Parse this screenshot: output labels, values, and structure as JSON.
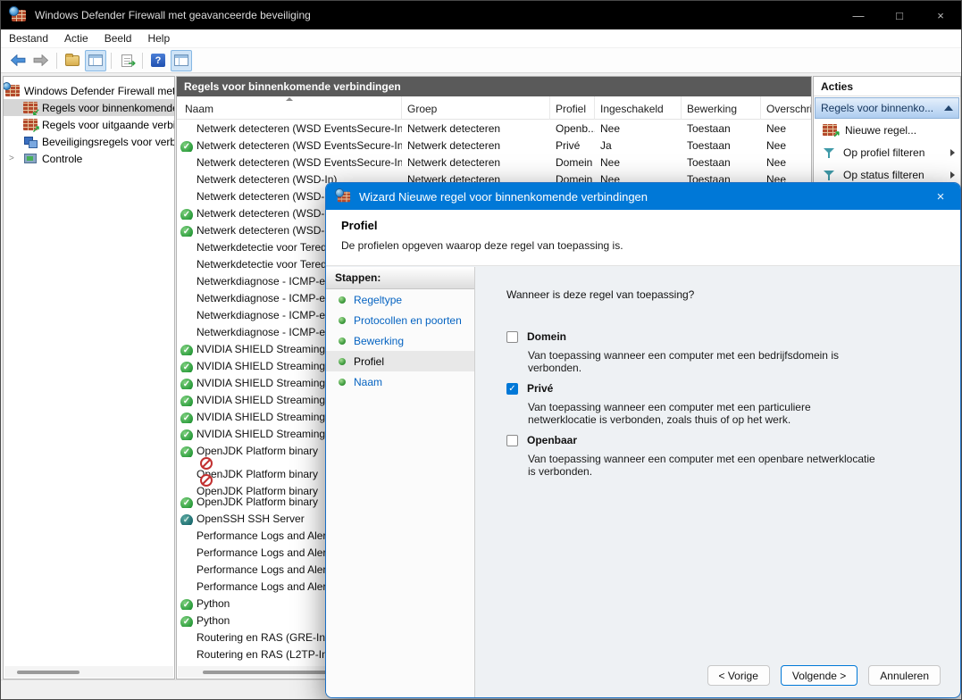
{
  "colors": {
    "accent": "#0078d7",
    "titlebar": "#000000",
    "panelheader": "#5a5a5a",
    "link": "#0563c1",
    "allowed": "#2e9e3e",
    "blocked": "#c23030"
  },
  "window": {
    "title": "Windows Defender Firewall met geavanceerde beveiliging",
    "minimize": "—",
    "maximize": "□",
    "close": "×"
  },
  "menu": {
    "items": [
      "Bestand",
      "Actie",
      "Beeld",
      "Help"
    ]
  },
  "tree": {
    "root": "Windows Defender Firewall met geavanceerde beveiliging",
    "items": [
      {
        "label": "Regels voor binnenkomende verbindingen",
        "icon": "inbound",
        "selected": true
      },
      {
        "label": "Regels voor uitgaande verbindingen",
        "icon": "outbound",
        "selected": false
      },
      {
        "label": "Beveiligingsregels voor verbindingen",
        "icon": "security",
        "selected": false
      },
      {
        "label": "Controle",
        "icon": "monitoring",
        "selected": false,
        "expander": ">"
      }
    ]
  },
  "listpanel": {
    "header": "Regels voor binnenkomende verbindingen",
    "columns": {
      "name": "Naam",
      "group": "Groep",
      "profile": "Profiel",
      "enabled": "Ingeschakeld",
      "action": "Bewerking",
      "override": "Overschrijven"
    },
    "rows": [
      {
        "icon": "",
        "name": "Netwerk detecteren (WSD EventsSecure-In)",
        "group": "Netwerk detecteren",
        "profile": "Openb...",
        "enabled": "Nee",
        "action": "Toestaan",
        "override": "Nee"
      },
      {
        "icon": "allowed",
        "name": "Netwerk detecteren (WSD EventsSecure-In)",
        "group": "Netwerk detecteren",
        "profile": "Privé",
        "enabled": "Ja",
        "action": "Toestaan",
        "override": "Nee"
      },
      {
        "icon": "",
        "name": "Netwerk detecteren (WSD EventsSecure-In)",
        "group": "Netwerk detecteren",
        "profile": "Domein",
        "enabled": "Nee",
        "action": "Toestaan",
        "override": "Nee"
      },
      {
        "icon": "",
        "name": "Netwerk detecteren (WSD-In)",
        "group": "Netwerk detecteren",
        "profile": "Domein",
        "enabled": "Nee",
        "action": "Toestaan",
        "override": "Nee"
      },
      {
        "icon": "",
        "name": "Netwerk detecteren (WSD-In)",
        "group": "",
        "profile": "",
        "enabled": "",
        "action": "",
        "override": ""
      },
      {
        "icon": "allowed",
        "name": "Netwerk detecteren (WSD-In)",
        "group": "",
        "profile": "",
        "enabled": "",
        "action": "",
        "override": ""
      },
      {
        "icon": "allowed",
        "name": "Netwerk detecteren (WSD-In)",
        "group": "",
        "profile": "",
        "enabled": "",
        "action": "",
        "override": ""
      },
      {
        "icon": "",
        "name": "Netwerkdetectie voor Teredo",
        "group": "",
        "profile": "",
        "enabled": "",
        "action": "",
        "override": ""
      },
      {
        "icon": "",
        "name": "Netwerkdetectie voor Teredo",
        "group": "",
        "profile": "",
        "enabled": "",
        "action": "",
        "override": ""
      },
      {
        "icon": "",
        "name": "Netwerkdiagnose - ICMP-ech",
        "group": "",
        "profile": "",
        "enabled": "",
        "action": "",
        "override": ""
      },
      {
        "icon": "",
        "name": "Netwerkdiagnose - ICMP-ech",
        "group": "",
        "profile": "",
        "enabled": "",
        "action": "",
        "override": ""
      },
      {
        "icon": "",
        "name": "Netwerkdiagnose - ICMP-ech",
        "group": "",
        "profile": "",
        "enabled": "",
        "action": "",
        "override": ""
      },
      {
        "icon": "",
        "name": "Netwerkdiagnose - ICMP-ech",
        "group": "",
        "profile": "",
        "enabled": "",
        "action": "",
        "override": ""
      },
      {
        "icon": "allowed",
        "name": "NVIDIA SHIELD Streaming Me",
        "group": "",
        "profile": "",
        "enabled": "",
        "action": "",
        "override": ""
      },
      {
        "icon": "allowed",
        "name": "NVIDIA SHIELD Streaming Me",
        "group": "",
        "profile": "",
        "enabled": "",
        "action": "",
        "override": ""
      },
      {
        "icon": "allowed",
        "name": "NVIDIA SHIELD Streaming Me",
        "group": "",
        "profile": "",
        "enabled": "",
        "action": "",
        "override": ""
      },
      {
        "icon": "allowed",
        "name": "NVIDIA SHIELD Streaming Me",
        "group": "",
        "profile": "",
        "enabled": "",
        "action": "",
        "override": ""
      },
      {
        "icon": "allowed",
        "name": "NVIDIA SHIELD Streaming Se",
        "group": "",
        "profile": "",
        "enabled": "",
        "action": "",
        "override": ""
      },
      {
        "icon": "allowed",
        "name": "NVIDIA SHIELD Streaming Se",
        "group": "",
        "profile": "",
        "enabled": "",
        "action": "",
        "override": ""
      },
      {
        "icon": "allowed",
        "name": "OpenJDK Platform binary",
        "group": "",
        "profile": "",
        "enabled": "",
        "action": "",
        "override": ""
      },
      {
        "icon": "blocked",
        "name": "OpenJDK Platform binary",
        "group": "",
        "profile": "",
        "enabled": "",
        "action": "",
        "override": ""
      },
      {
        "icon": "blocked",
        "name": "OpenJDK Platform binary",
        "group": "",
        "profile": "",
        "enabled": "",
        "action": "",
        "override": ""
      },
      {
        "icon": "allowed",
        "name": "OpenJDK Platform binary",
        "group": "",
        "profile": "",
        "enabled": "",
        "action": "",
        "override": ""
      },
      {
        "icon": "dark",
        "name": "OpenSSH SSH Server",
        "group": "",
        "profile": "",
        "enabled": "",
        "action": "",
        "override": ""
      },
      {
        "icon": "",
        "name": "Performance Logs and Alert",
        "group": "",
        "profile": "",
        "enabled": "",
        "action": "",
        "override": ""
      },
      {
        "icon": "",
        "name": "Performance Logs and Alert",
        "group": "",
        "profile": "",
        "enabled": "",
        "action": "",
        "override": ""
      },
      {
        "icon": "",
        "name": "Performance Logs and Alert",
        "group": "",
        "profile": "",
        "enabled": "",
        "action": "",
        "override": ""
      },
      {
        "icon": "",
        "name": "Performance Logs and Alert",
        "group": "",
        "profile": "",
        "enabled": "",
        "action": "",
        "override": ""
      },
      {
        "icon": "allowed",
        "name": "Python",
        "group": "",
        "profile": "",
        "enabled": "",
        "action": "",
        "override": ""
      },
      {
        "icon": "allowed",
        "name": "Python",
        "group": "",
        "profile": "",
        "enabled": "",
        "action": "",
        "override": ""
      },
      {
        "icon": "",
        "name": "Routering en RAS (GRE-In)",
        "group": "",
        "profile": "",
        "enabled": "",
        "action": "",
        "override": ""
      },
      {
        "icon": "",
        "name": "Routering en RAS (L2TP-In)",
        "group": "",
        "profile": "",
        "enabled": "",
        "action": "",
        "override": ""
      }
    ]
  },
  "actions": {
    "title": "Acties",
    "section": "Regels voor binnenko...",
    "items": [
      {
        "label": "Nieuwe regel...",
        "icon": "new-rule",
        "submenu": false
      },
      {
        "label": "Op profiel filteren",
        "icon": "filter",
        "submenu": true
      },
      {
        "label": "Op status filteren",
        "icon": "filter",
        "submenu": true
      }
    ]
  },
  "wizard": {
    "title": "Wizard Nieuwe regel voor binnenkomende verbindingen",
    "close": "×",
    "page_title": "Profiel",
    "page_desc": "De profielen opgeven waarop deze regel van toepassing is.",
    "steps_label": "Stappen:",
    "steps": [
      {
        "label": "Regeltype",
        "current": false
      },
      {
        "label": "Protocollen en poorten",
        "current": false
      },
      {
        "label": "Bewerking",
        "current": false
      },
      {
        "label": "Profiel",
        "current": true
      },
      {
        "label": "Naam",
        "current": false
      }
    ],
    "question": "Wanneer is deze regel van toepassing?",
    "options": [
      {
        "label": "Domein",
        "checked": false,
        "desc": "Van toepassing wanneer een computer met een bedrijfsdomein is verbonden."
      },
      {
        "label": "Privé",
        "checked": true,
        "desc": "Van toepassing wanneer een computer met een particuliere netwerklocatie is verbonden, zoals thuis of op het werk."
      },
      {
        "label": "Openbaar",
        "checked": false,
        "desc": "Van toepassing wanneer een computer met een openbare netwerklocatie is verbonden."
      }
    ],
    "buttons": {
      "back": "< Vorige",
      "next": "Volgende >",
      "cancel": "Annuleren"
    }
  }
}
